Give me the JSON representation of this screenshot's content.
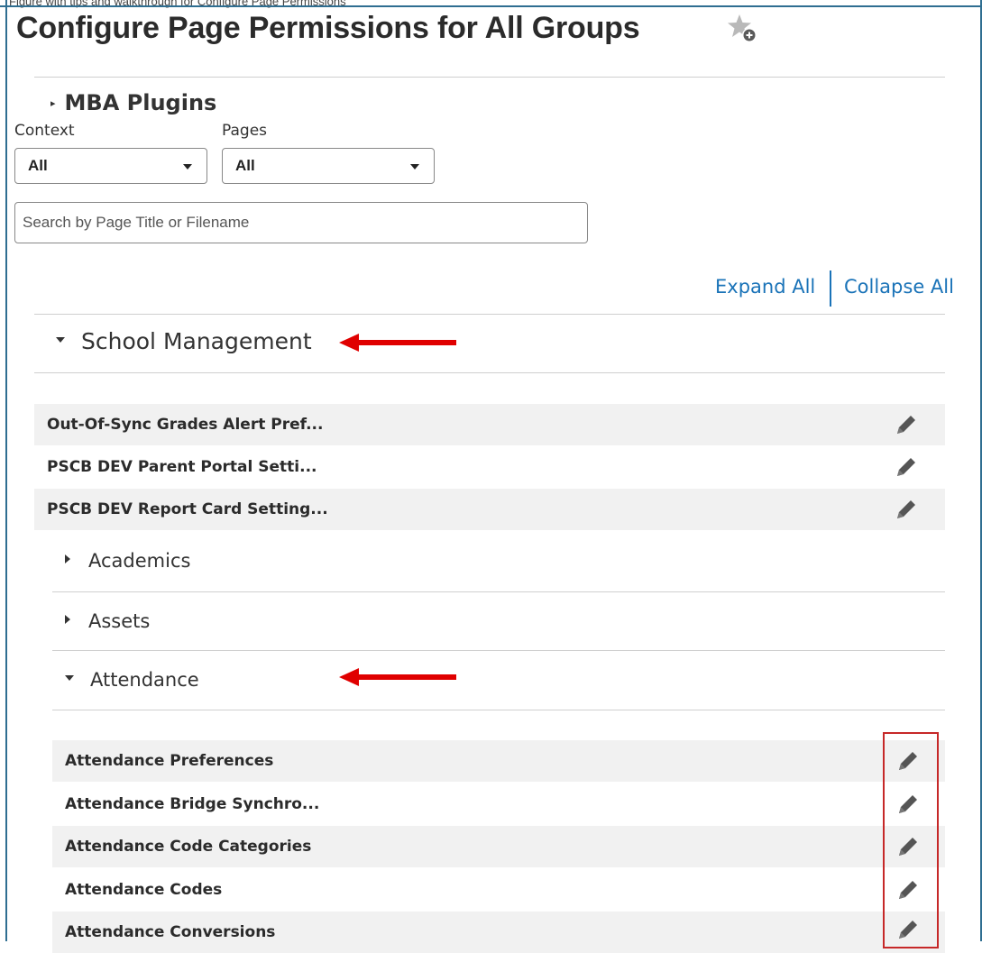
{
  "page": {
    "top_cut_text": "Figure with tips and walkthrough for Configure Page Permissions",
    "title": "Configure Page Permissions for All Groups"
  },
  "icons": {
    "favorite": "star-add-icon",
    "edit": "pencil-icon",
    "collapsed": "caret-right-icon",
    "expanded": "caret-down-icon",
    "dropdown": "chevron-down-icon"
  },
  "plugins": {
    "label": "MBA Plugins"
  },
  "filters": {
    "context_label": "Context",
    "context_value": "All",
    "pages_label": "Pages",
    "pages_value": "All",
    "search_placeholder": "Search by Page Title or Filename"
  },
  "actions": {
    "expand_all": "Expand All",
    "collapse_all": "Collapse All"
  },
  "sections": {
    "school_management": {
      "title": "School Management",
      "pages": [
        "Out-Of-Sync Grades Alert Pref...",
        "PSCB DEV Parent Portal Setti...",
        "PSCB DEV Report Card Setting..."
      ]
    },
    "subsections": [
      {
        "title": "Academics"
      },
      {
        "title": "Assets"
      },
      {
        "title": "Attendance"
      }
    ],
    "attendance_pages": [
      "Attendance Preferences",
      "Attendance Bridge Synchro...",
      "Attendance Code Categories",
      "Attendance Codes",
      "Attendance Conversions"
    ]
  },
  "colors": {
    "link": "#1a73b8",
    "annotation": "#e00000",
    "row_shade": "#f1f1f1",
    "frame": "#2f6e91"
  }
}
